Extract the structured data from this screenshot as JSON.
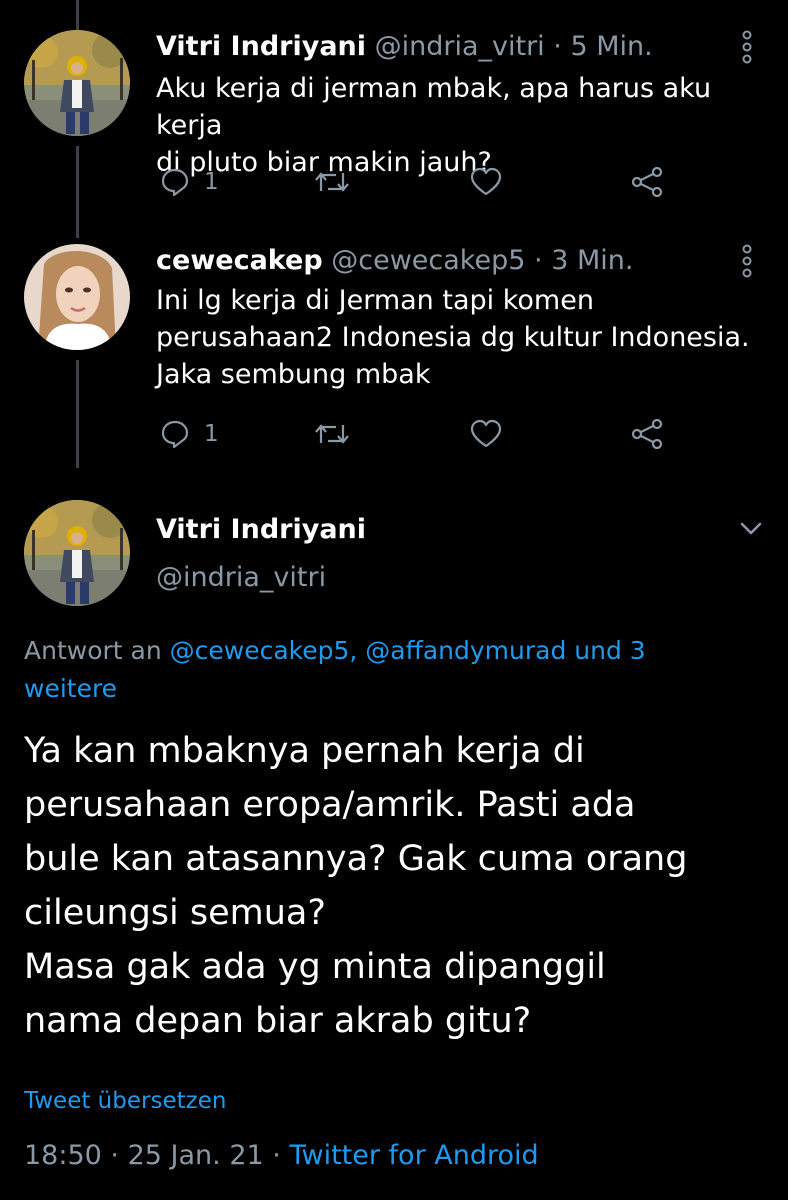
{
  "thread": [
    {
      "name": "Vitri Indriyani",
      "handle": "@indria_vitri",
      "separator": "·",
      "time": "5 Min.",
      "text_lines": [
        "Aku kerja di jerman mbak, apa harus aku kerja",
        "di pluto biar makin jauh?"
      ],
      "reply_count": "1",
      "avatar_icon": "avatar-photo-woman-hijab"
    },
    {
      "name": "cewecakep",
      "handle": "@cewecakep5",
      "separator": "·",
      "time": "3 Min.",
      "text_lines": [
        "Ini lg kerja di Jerman tapi komen",
        "perusahaan2 Indonesia dg kultur Indonesia.",
        "Jaka sembung mbak"
      ],
      "reply_count": "1",
      "avatar_icon": "avatar-photo-woman"
    }
  ],
  "main_tweet": {
    "name": "Vitri Indriyani",
    "handle": "@indria_vitri",
    "reply_prefix": "Antwort an",
    "reply_mentions_line1": "@cewecakep5, @affandymurad und 3",
    "reply_mentions_line2": "weitere",
    "text_lines": [
      "Ya kan mbaknya pernah kerja di",
      "perusahaan eropa/amrik. Pasti ada",
      "bule kan atasannya? Gak cuma orang",
      "cileungsi semua?",
      "Masa gak ada yg minta dipanggil",
      "nama depan biar akrab gitu?"
    ],
    "translate_label": "Tweet übersetzen",
    "time": "18:50",
    "separator": "·",
    "date": "25 Jan. 21",
    "source": "Twitter for Android"
  },
  "colors": {
    "background": "#000000",
    "text": "#ffffff",
    "muted": "#8b98a5",
    "link": "#1d9bf0",
    "thread_line": "#3d4147"
  }
}
